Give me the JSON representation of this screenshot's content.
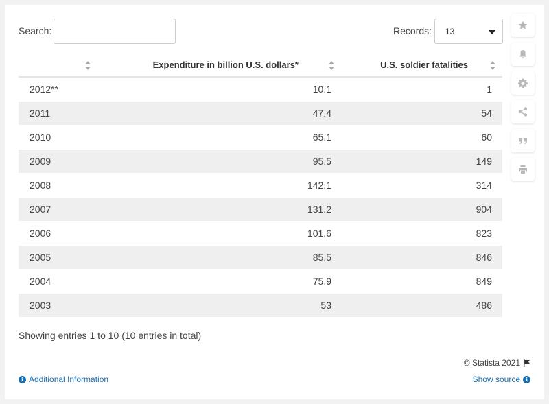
{
  "search": {
    "label": "Search:",
    "value": ""
  },
  "records": {
    "label": "Records:",
    "selected": "13"
  },
  "table": {
    "headers": [
      "",
      "Expenditure in billion U.S. dollars*",
      "U.S. soldier fatalities"
    ],
    "rows": [
      [
        "2012**",
        "10.1",
        "1"
      ],
      [
        "2011",
        "47.4",
        "54"
      ],
      [
        "2010",
        "65.1",
        "60"
      ],
      [
        "2009",
        "95.5",
        "149"
      ],
      [
        "2008",
        "142.1",
        "314"
      ],
      [
        "2007",
        "131.2",
        "904"
      ],
      [
        "2006",
        "101.6",
        "823"
      ],
      [
        "2005",
        "85.5",
        "846"
      ],
      [
        "2004",
        "75.9",
        "849"
      ],
      [
        "2003",
        "53",
        "486"
      ]
    ]
  },
  "footer": {
    "showing": "Showing entries 1 to 10 (10 entries in total)",
    "copyright": "© Statista 2021",
    "additional_info": "Additional Information",
    "show_source": "Show source"
  },
  "sidebar_icons": [
    "star-icon",
    "bell-icon",
    "gear-icon",
    "share-icon",
    "quote-icon",
    "print-icon"
  ],
  "colors": {
    "link": "#1a6fb0",
    "row_alt": "#efefef",
    "icon": "#b8b8b8"
  }
}
